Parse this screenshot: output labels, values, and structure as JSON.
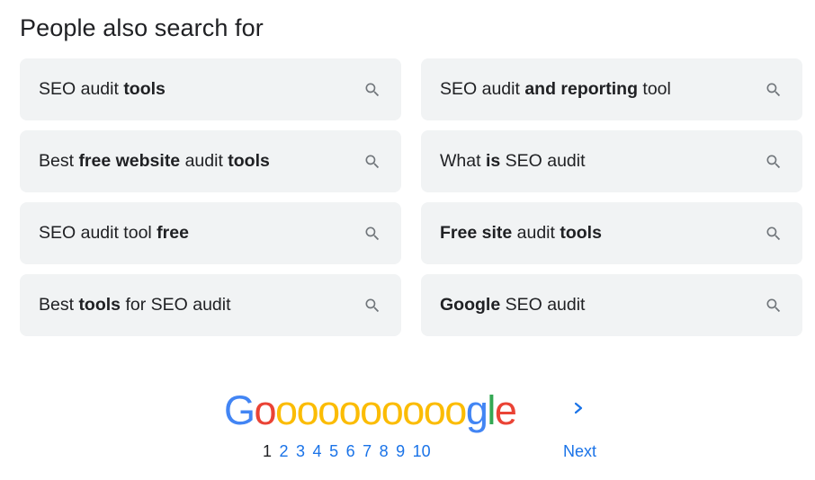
{
  "section": {
    "title": "People also search for"
  },
  "suggestions": [
    {
      "parts": [
        {
          "t": "SEO audit ",
          "b": false
        },
        {
          "t": "tools",
          "b": true
        }
      ]
    },
    {
      "parts": [
        {
          "t": "SEO audit ",
          "b": false
        },
        {
          "t": "and reporting",
          "b": true
        },
        {
          "t": " tool",
          "b": false
        }
      ]
    },
    {
      "parts": [
        {
          "t": "Best ",
          "b": false
        },
        {
          "t": "free website",
          "b": true
        },
        {
          "t": " audit ",
          "b": false
        },
        {
          "t": "tools",
          "b": true
        }
      ]
    },
    {
      "parts": [
        {
          "t": "What ",
          "b": false
        },
        {
          "t": "is",
          "b": true
        },
        {
          "t": " SEO audit",
          "b": false
        }
      ]
    },
    {
      "parts": [
        {
          "t": "SEO audit tool ",
          "b": false
        },
        {
          "t": "free",
          "b": true
        }
      ]
    },
    {
      "parts": [
        {
          "t": "Free site",
          "b": true
        },
        {
          "t": " audit ",
          "b": false
        },
        {
          "t": "tools",
          "b": true
        }
      ]
    },
    {
      "parts": [
        {
          "t": "Best ",
          "b": false
        },
        {
          "t": "tools",
          "b": true
        },
        {
          "t": " for SEO audit",
          "b": false
        }
      ]
    },
    {
      "parts": [
        {
          "t": "Google",
          "b": true
        },
        {
          "t": " SEO audit",
          "b": false
        }
      ]
    }
  ],
  "pagination": {
    "logo_letters": [
      {
        "ch": "G",
        "color": "#4285f4"
      },
      {
        "ch": "o",
        "color": "#ea4335"
      },
      {
        "ch": "o",
        "color": "#fbbc04"
      },
      {
        "ch": "o",
        "color": "#fbbc04"
      },
      {
        "ch": "o",
        "color": "#fbbc04"
      },
      {
        "ch": "o",
        "color": "#fbbc04"
      },
      {
        "ch": "o",
        "color": "#fbbc04"
      },
      {
        "ch": "o",
        "color": "#fbbc04"
      },
      {
        "ch": "o",
        "color": "#fbbc04"
      },
      {
        "ch": "o",
        "color": "#fbbc04"
      },
      {
        "ch": "o",
        "color": "#fbbc04"
      },
      {
        "ch": "g",
        "color": "#4285f4"
      },
      {
        "ch": "l",
        "color": "#34a853"
      },
      {
        "ch": "e",
        "color": "#ea4335"
      }
    ],
    "current_page": "1",
    "pages": [
      "1",
      "2",
      "3",
      "4",
      "5",
      "6",
      "7",
      "8",
      "9",
      "10"
    ],
    "next_label": "Next",
    "link_color": "#1a73e8",
    "chevron_icon": "chevron-right-icon"
  },
  "colors": {
    "chip_background": "#f1f3f4",
    "text": "#202124",
    "icon": "#70757a"
  }
}
